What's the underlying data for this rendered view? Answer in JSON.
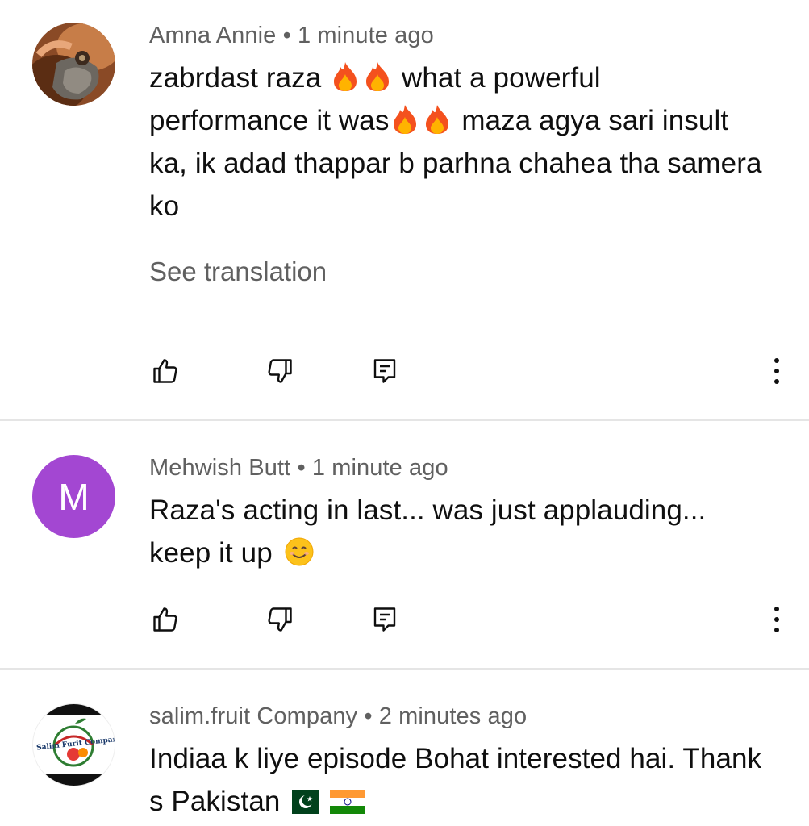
{
  "comments": [
    {
      "author": "Amna Annie",
      "time": "• 1 minute ago",
      "line1_a": "zabrdast raza",
      "line1_b": "what a powerful",
      "line2_a": "performance it was",
      "line2_b": "maza agya sari insult",
      "line3": "ka, ik adad thappar b parhna chahea tha samera",
      "line4": "ko",
      "see_translation": "See translation",
      "avatar_icon": "photo-avatar"
    },
    {
      "author": "Mehwish Butt",
      "time": "• 1 minute ago",
      "line1": "Raza's acting in last... was just applauding...",
      "line2": "keep it up",
      "avatar_letter": "M",
      "avatar_color": "#a347d2"
    },
    {
      "author": "salim.fruit Company",
      "time": "• 2 minutes ago",
      "line1": "Indiaa k liye episode Bohat interested hai. Thank",
      "line2": "s Pakistan",
      "avatar_text": "Salim Furit Company"
    }
  ],
  "icons": {
    "like": "thumbs-up-icon",
    "dislike": "thumbs-down-icon",
    "reply": "reply-icon",
    "more": "more-vert-icon"
  },
  "colors": {
    "meta": "#606060",
    "divider": "#e5e5e5"
  }
}
